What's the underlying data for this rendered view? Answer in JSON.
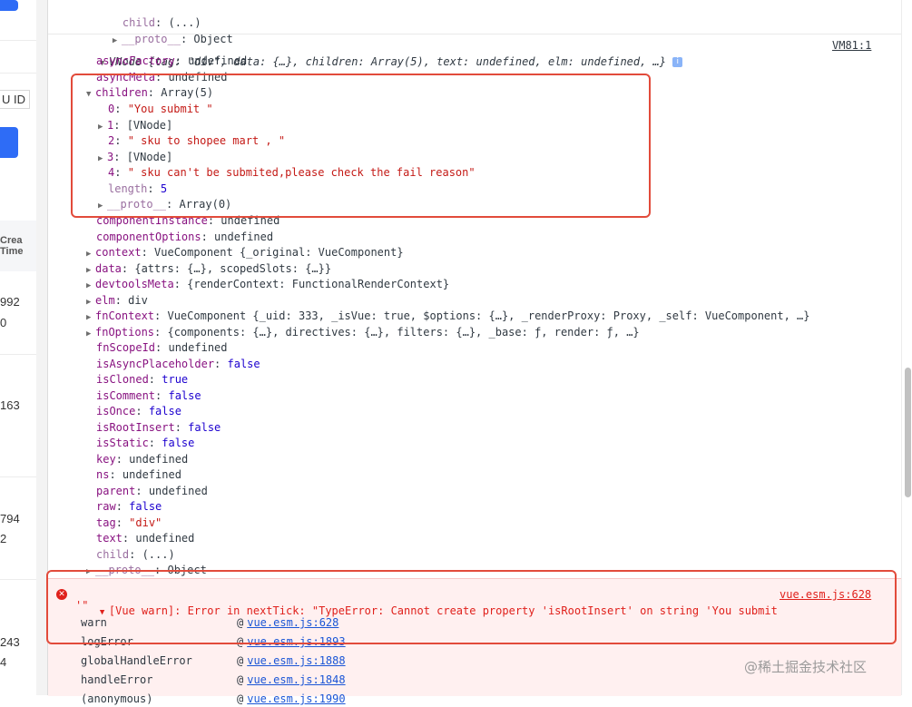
{
  "left_panel": {
    "col_partial": "U ID",
    "col_header_1": "Crea",
    "col_header_2": "Time",
    "values": [
      "992",
      "0",
      "163",
      "794",
      "2",
      "243",
      "4"
    ]
  },
  "console": {
    "top_child": "child",
    "top_child_val": ": (...)",
    "top_proto": "__proto__",
    "top_proto_val": ": Object",
    "vnode_label": "VNode",
    "vnode_summary": "{tag: \"div\", data: {…}, children: Array(5), text: undefined, elm: undefined, …}",
    "vnode_source": "VM81:1",
    "props": [
      {
        "key": "asyncFactory",
        "val": "undefined",
        "cls": "dim"
      },
      {
        "key": "asyncMeta",
        "val": "undefined",
        "cls": "dim"
      }
    ],
    "children": {
      "key": "children",
      "val": "Array(5)",
      "items": [
        {
          "idx": "0",
          "val": "\"You submit \"",
          "cls": "str",
          "expand": false
        },
        {
          "idx": "1",
          "val": "[VNode]",
          "cls": "dim",
          "expand": true
        },
        {
          "idx": "2",
          "val": "\" sku to shopee mart , \"",
          "cls": "str",
          "expand": false
        },
        {
          "idx": "3",
          "val": "[VNode]",
          "cls": "dim",
          "expand": true
        },
        {
          "idx": "4",
          "val": "\" sku can't be submited,please check the fail reason\"",
          "cls": "str",
          "expand": false
        }
      ],
      "length_key": "length",
      "length_val": "5",
      "proto_key": "__proto__",
      "proto_val": "Array(0)"
    },
    "rest": [
      {
        "key": "componentInstance",
        "val": "undefined",
        "cls": "dim",
        "expand": false
      },
      {
        "key": "componentOptions",
        "val": "undefined",
        "cls": "dim",
        "expand": false
      },
      {
        "key": "context",
        "val": "VueComponent {_original: VueComponent}",
        "cls": "dim",
        "expand": true
      },
      {
        "key": "data",
        "val": "{attrs: {…}, scopedSlots: {…}}",
        "cls": "dim",
        "expand": true
      },
      {
        "key": "devtoolsMeta",
        "val": "{renderContext: FunctionalRenderContext}",
        "cls": "dim",
        "expand": true
      },
      {
        "key": "elm",
        "val": "div",
        "cls": "dim",
        "expand": true
      },
      {
        "key": "fnContext",
        "val": "VueComponent {_uid: 333, _isVue: true, $options: {…}, _renderProxy: Proxy, _self: VueComponent, …}",
        "cls": "dim",
        "expand": true
      },
      {
        "key": "fnOptions",
        "val": "{components: {…}, directives: {…}, filters: {…}, _base: ƒ, render: ƒ, …}",
        "cls": "dim",
        "expand": true
      },
      {
        "key": "fnScopeId",
        "val": "undefined",
        "cls": "dim",
        "expand": false
      },
      {
        "key": "isAsyncPlaceholder",
        "val": "false",
        "cls": "kw",
        "expand": false
      },
      {
        "key": "isCloned",
        "val": "true",
        "cls": "kw",
        "expand": false
      },
      {
        "key": "isComment",
        "val": "false",
        "cls": "kw",
        "expand": false
      },
      {
        "key": "isOnce",
        "val": "false",
        "cls": "kw",
        "expand": false
      },
      {
        "key": "isRootInsert",
        "val": "false",
        "cls": "kw",
        "expand": false
      },
      {
        "key": "isStatic",
        "val": "false",
        "cls": "kw",
        "expand": false
      },
      {
        "key": "key",
        "val": "undefined",
        "cls": "dim",
        "expand": false
      },
      {
        "key": "ns",
        "val": "undefined",
        "cls": "dim",
        "expand": false
      },
      {
        "key": "parent",
        "val": "undefined",
        "cls": "dim",
        "expand": false
      },
      {
        "key": "raw",
        "val": "false",
        "cls": "kw",
        "expand": false
      },
      {
        "key": "tag",
        "val": "\"div\"",
        "cls": "str",
        "expand": false
      },
      {
        "key": "text",
        "val": "undefined",
        "cls": "dim",
        "expand": false
      },
      {
        "key": "child",
        "val": "(...)",
        "cls": "dim",
        "expand": false,
        "faded": true
      },
      {
        "key": "__proto__",
        "val": "Object",
        "cls": "dim",
        "expand": true,
        "faded": true
      }
    ]
  },
  "error": {
    "message": "[Vue warn]: Error in nextTick: \"TypeError: Cannot create property 'isRootInsert' on string 'You submit ",
    "message_cont": "'\"",
    "source": "vue.esm.js:628",
    "stack": [
      {
        "fn": "warn",
        "at": "@",
        "link": "vue.esm.js:628"
      },
      {
        "fn": "logError",
        "at": "@",
        "link": "vue.esm.js:1893"
      },
      {
        "fn": "globalHandleError",
        "at": "@",
        "link": "vue.esm.js:1888"
      },
      {
        "fn": "handleError",
        "at": "@",
        "link": "vue.esm.js:1848"
      },
      {
        "fn": "(anonymous)",
        "at": "@",
        "link": "vue.esm.js:1990"
      }
    ]
  },
  "watermark": "@稀土掘金技术社区"
}
